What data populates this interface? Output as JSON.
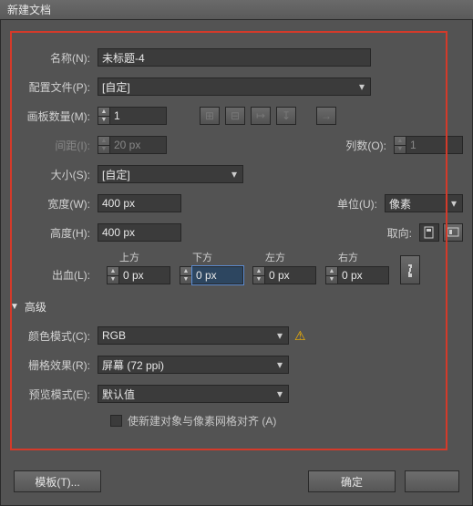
{
  "title": "新建文档",
  "labels": {
    "name": "名称(N):",
    "profile": "配置文件(P):",
    "artboards": "画板数量(M):",
    "spacing": "间距(I):",
    "columns": "列数(O):",
    "size": "大小(S):",
    "width": "宽度(W):",
    "height": "高度(H):",
    "units": "单位(U):",
    "orient": "取向:",
    "bleed": "出血(L):",
    "top": "上方",
    "bottom": "下方",
    "left": "左方",
    "right": "右方",
    "advanced": "高级",
    "colormode": "颜色模式(C):",
    "raster": "栅格效果(R):",
    "preview": "预览模式(E):",
    "align_pixel": "使新建对象与像素网格对齐 (A)",
    "templates": "模板(T)...",
    "ok": "确定"
  },
  "values": {
    "name": "未标题-4",
    "profile": "[自定]",
    "artboards": "1",
    "spacing": "20 px",
    "columns": "1",
    "size": "[自定]",
    "width": "400 px",
    "height": "400 px",
    "units": "像素",
    "bleed_top": "0 px",
    "bleed_bottom": "0 px",
    "bleed_left": "0 px",
    "bleed_right": "0 px",
    "colormode": "RGB",
    "raster": "屏幕 (72 ppi)",
    "preview": "默认值"
  }
}
